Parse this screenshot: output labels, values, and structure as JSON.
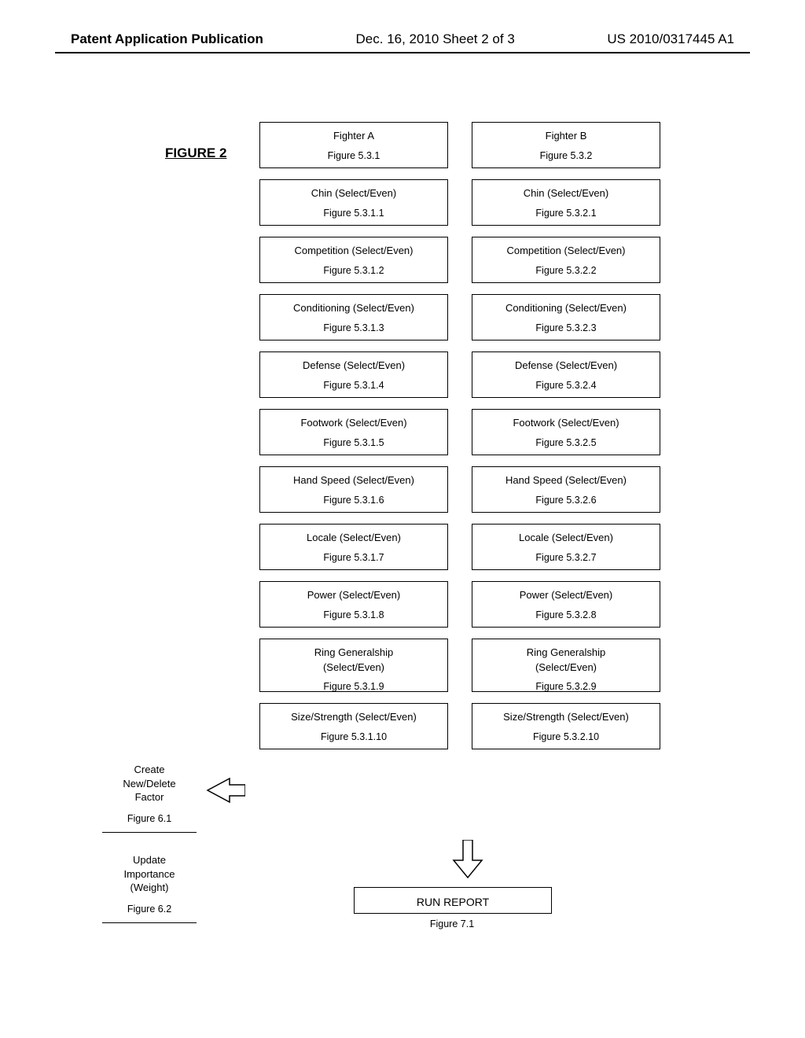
{
  "header": {
    "left": "Patent Application Publication",
    "mid": "Dec. 16, 2010  Sheet 2 of 3",
    "right": "US 2010/0317445 A1"
  },
  "figure_title": "FIGURE 2",
  "colA": {
    "head": {
      "t1": "Fighter A",
      "t2": "Figure 5.3.1"
    },
    "rows": [
      {
        "t1": "Chin (Select/Even)",
        "t2": "Figure 5.3.1.1"
      },
      {
        "t1": "Competition (Select/Even)",
        "t2": "Figure 5.3.1.2"
      },
      {
        "t1": "Conditioning (Select/Even)",
        "t2": "Figure 5.3.1.3"
      },
      {
        "t1": "Defense (Select/Even)",
        "t2": "Figure 5.3.1.4"
      },
      {
        "t1": "Footwork (Select/Even)",
        "t2": "Figure 5.3.1.5"
      },
      {
        "t1": "Hand Speed (Select/Even)",
        "t2": "Figure 5.3.1.6"
      },
      {
        "t1": "Locale (Select/Even)",
        "t2": "Figure 5.3.1.7"
      },
      {
        "t1": "Power (Select/Even)",
        "t2": "Figure 5.3.1.8"
      },
      {
        "t1": "Ring Generalship (Select/Even)",
        "t2": "Figure 5.3.1.9"
      },
      {
        "t1": "Size/Strength (Select/Even)",
        "t2": "Figure 5.3.1.10"
      }
    ]
  },
  "colB": {
    "head": {
      "t1": "Fighter B",
      "t2": "Figure 5.3.2"
    },
    "rows": [
      {
        "t1": "Chin (Select/Even)",
        "t2": "Figure 5.3.2.1"
      },
      {
        "t1": "Competition (Select/Even)",
        "t2": "Figure 5.3.2.2"
      },
      {
        "t1": "Conditioning (Select/Even)",
        "t2": "Figure 5.3.2.3"
      },
      {
        "t1": "Defense (Select/Even)",
        "t2": "Figure 5.3.2.4"
      },
      {
        "t1": "Footwork (Select/Even)",
        "t2": "Figure 5.3.2.5"
      },
      {
        "t1": "Hand Speed (Select/Even)",
        "t2": "Figure 5.3.2.6"
      },
      {
        "t1": "Locale (Select/Even)",
        "t2": "Figure 5.3.2.7"
      },
      {
        "t1": "Power (Select/Even)",
        "t2": "Figure 5.3.2.8"
      },
      {
        "t1": "Ring Generalship (Select/Even)",
        "t2": "Figure 5.3.2.9"
      },
      {
        "t1": "Size/Strength (Select/Even)",
        "t2": "Figure 5.3.2.10"
      }
    ]
  },
  "side1": {
    "l1": "Create",
    "l2": "New/Delete",
    "l3": "Factor",
    "fig": "Figure 6.1"
  },
  "side2": {
    "l1": "Update",
    "l2": "Importance",
    "l3": "(Weight)",
    "fig": "Figure 6.2"
  },
  "run": {
    "label": "RUN REPORT",
    "fig": "Figure 7.1"
  }
}
